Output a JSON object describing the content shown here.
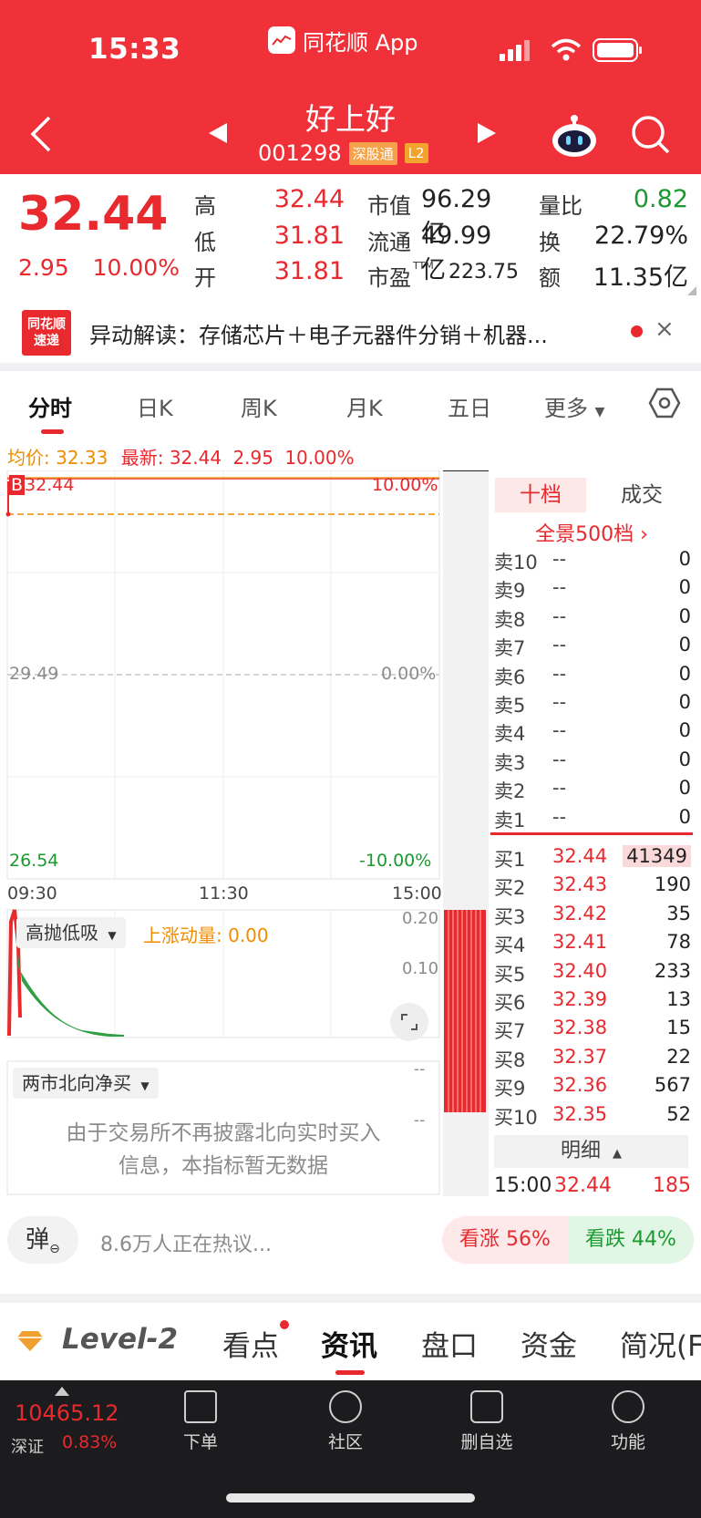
{
  "status": {
    "time": "15:33",
    "app_name": "同花顺 App"
  },
  "header": {
    "title": "好上好",
    "code": "001298",
    "tag_market": "深股通",
    "tag_level": "L2"
  },
  "quote": {
    "price": "32.44",
    "change": "2.95",
    "change_pct": "10.00%",
    "labels": {
      "high": "高",
      "low": "低",
      "open": "开",
      "mcap": "市值",
      "float": "流通",
      "pe": "市盈",
      "pe_sup": "TTM",
      "vol_ratio": "量比",
      "turnover": "换",
      "amount": "额"
    },
    "high": "32.44",
    "low": "31.81",
    "open": "31.81",
    "mcap": "96.29亿",
    "float": "49.99亿",
    "pe": "223.75",
    "vol_ratio": "0.82",
    "turnover": "22.79%",
    "amount": "11.35亿"
  },
  "news": {
    "logo_line1": "同花顺",
    "logo_line2": "速递",
    "text": "异动解读：存储芯片＋电子元器件分销＋机器...",
    "close": "×"
  },
  "tabs": [
    "分时",
    "日K",
    "周K",
    "月K",
    "五日",
    "更多"
  ],
  "chart": {
    "avg_label": "均价: 32.33",
    "latest_label": "最新: 32.44",
    "latest_chg": "2.95",
    "latest_pct": "10.00%",
    "y_top": "32.44",
    "y_top_pct": "10.00%",
    "y_mid": "29.49",
    "y_mid_pct": "0.00%",
    "y_bot": "26.54",
    "y_bot_pct": "-10.00%",
    "t_start": "09:30",
    "t_mid": "11:30",
    "t_end": "15:00",
    "marker": "B"
  },
  "indicator": {
    "name": "高抛低吸",
    "momentum": "上涨动量: 0.00",
    "y1": "0.20",
    "y2": "0.10"
  },
  "northbound": {
    "name": "两市北向净买",
    "msg_line1": "由于交易所不再披露北向实时买入",
    "msg_line2": "信息，本指标暂无数据",
    "dash1": "--",
    "dash2": "--"
  },
  "orderbook": {
    "tab_10": "十档",
    "tab_trades": "成交",
    "full_depth": "全景500档",
    "asks": [
      {
        "label": "卖10",
        "price": "--",
        "vol": "0"
      },
      {
        "label": "卖9",
        "price": "--",
        "vol": "0"
      },
      {
        "label": "卖8",
        "price": "--",
        "vol": "0"
      },
      {
        "label": "卖7",
        "price": "--",
        "vol": "0"
      },
      {
        "label": "卖6",
        "price": "--",
        "vol": "0"
      },
      {
        "label": "卖5",
        "price": "--",
        "vol": "0"
      },
      {
        "label": "卖4",
        "price": "--",
        "vol": "0"
      },
      {
        "label": "卖3",
        "price": "--",
        "vol": "0"
      },
      {
        "label": "卖2",
        "price": "--",
        "vol": "0"
      },
      {
        "label": "卖1",
        "price": "--",
        "vol": "0"
      }
    ],
    "bids": [
      {
        "label": "买1",
        "price": "32.44",
        "vol": "41349"
      },
      {
        "label": "买2",
        "price": "32.43",
        "vol": "190"
      },
      {
        "label": "买3",
        "price": "32.42",
        "vol": "35"
      },
      {
        "label": "买4",
        "price": "32.41",
        "vol": "78"
      },
      {
        "label": "买5",
        "price": "32.40",
        "vol": "233"
      },
      {
        "label": "买6",
        "price": "32.39",
        "vol": "13"
      },
      {
        "label": "买7",
        "price": "32.38",
        "vol": "15"
      },
      {
        "label": "买8",
        "price": "32.37",
        "vol": "22"
      },
      {
        "label": "买9",
        "price": "32.36",
        "vol": "567"
      },
      {
        "label": "买10",
        "price": "32.35",
        "vol": "52"
      }
    ],
    "detail": "明细",
    "last_trade": {
      "time": "15:00",
      "price": "32.44",
      "vol": "185"
    }
  },
  "social": {
    "danmaku": "弹",
    "hot": "8.6万人正在热议...",
    "bull": "看涨 56%",
    "bear": "看跌 44%"
  },
  "nav": [
    "Level-2",
    "看点",
    "资讯",
    "盘口",
    "资金",
    "简况(F"
  ],
  "bottom": {
    "index_value": "10465.12",
    "index_name": "深证",
    "index_pct": "0.83%",
    "items": [
      "下单",
      "社区",
      "删自选",
      "功能"
    ]
  }
}
